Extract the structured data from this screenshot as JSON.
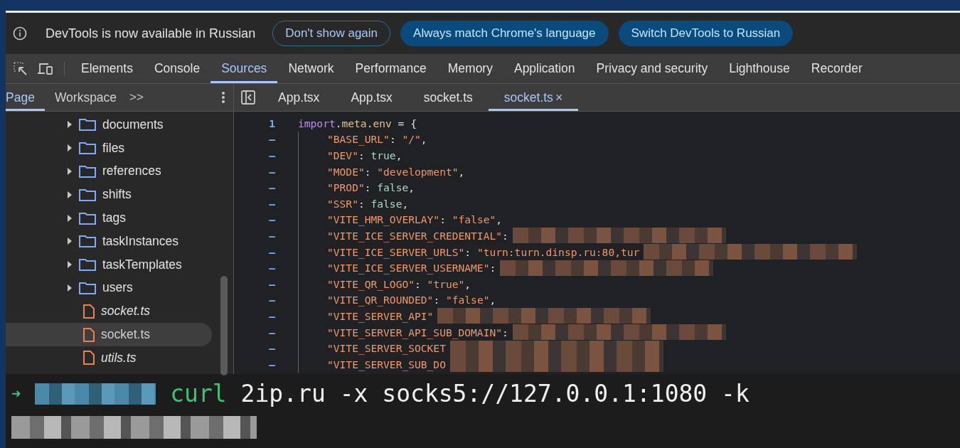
{
  "infobar": {
    "message": "DevTools is now available in Russian",
    "buttons": [
      {
        "label": "Don't show again",
        "kind": "outline"
      },
      {
        "label": "Always match Chrome's language",
        "kind": "filled"
      },
      {
        "label": "Switch DevTools to Russian",
        "kind": "filled"
      }
    ]
  },
  "panel_tabs": [
    {
      "label": "Elements",
      "selected": false
    },
    {
      "label": "Console",
      "selected": false
    },
    {
      "label": "Sources",
      "selected": true
    },
    {
      "label": "Network",
      "selected": false
    },
    {
      "label": "Performance",
      "selected": false
    },
    {
      "label": "Memory",
      "selected": false
    },
    {
      "label": "Application",
      "selected": false
    },
    {
      "label": "Privacy and security",
      "selected": false
    },
    {
      "label": "Lighthouse",
      "selected": false
    },
    {
      "label": "Recorder",
      "selected": false
    }
  ],
  "navigator_tabs": [
    {
      "label": "Page",
      "selected": true
    },
    {
      "label": "Workspace",
      "selected": false
    }
  ],
  "more_tabs": ">>",
  "file_tree": [
    {
      "name": "documents",
      "kind": "folder",
      "expanded": false,
      "italic": false,
      "selected": false
    },
    {
      "name": "files",
      "kind": "folder",
      "expanded": false,
      "italic": false,
      "selected": false
    },
    {
      "name": "references",
      "kind": "folder",
      "expanded": false,
      "italic": false,
      "selected": false
    },
    {
      "name": "shifts",
      "kind": "folder",
      "expanded": false,
      "italic": false,
      "selected": false
    },
    {
      "name": "tags",
      "kind": "folder",
      "expanded": false,
      "italic": false,
      "selected": false
    },
    {
      "name": "taskInstances",
      "kind": "folder",
      "expanded": false,
      "italic": false,
      "selected": false
    },
    {
      "name": "taskTemplates",
      "kind": "folder",
      "expanded": false,
      "italic": false,
      "selected": false
    },
    {
      "name": "users",
      "kind": "folder",
      "expanded": false,
      "italic": false,
      "selected": false
    },
    {
      "name": "socket.ts",
      "kind": "file",
      "italic": true,
      "selected": false
    },
    {
      "name": "socket.ts",
      "kind": "file",
      "italic": false,
      "selected": true
    },
    {
      "name": "utils.ts",
      "kind": "file",
      "italic": true,
      "selected": false
    }
  ],
  "editor_tabs": [
    {
      "label": "App.tsx",
      "selected": false,
      "closable": false
    },
    {
      "label": "App.tsx",
      "selected": false,
      "closable": false
    },
    {
      "label": "socket.ts",
      "selected": false,
      "closable": false
    },
    {
      "label": "socket.ts",
      "selected": true,
      "closable": true
    }
  ],
  "close_glyph": "×",
  "code": [
    {
      "gutter": "1",
      "redacted": false,
      "tokens": [
        {
          "text": "import",
          "kind": "keyword"
        },
        {
          "text": ".",
          "kind": "punct"
        },
        {
          "text": "meta",
          "kind": "member"
        },
        {
          "text": ".",
          "kind": "punct"
        },
        {
          "text": "env",
          "kind": "member"
        },
        {
          "text": " = {",
          "kind": "punct"
        }
      ],
      "children": [
        {
          "gutter": "–",
          "redacted": false,
          "tokens": [
            {
              "text": "\"BASE_URL\"",
              "kind": "string"
            },
            {
              "text": ": ",
              "kind": "punct"
            },
            {
              "text": "\"/\"",
              "kind": "string"
            },
            {
              "text": ",",
              "kind": "punct"
            }
          ]
        },
        {
          "gutter": "–",
          "redacted": false,
          "tokens": [
            {
              "text": "\"DEV\"",
              "kind": "string"
            },
            {
              "text": ": ",
              "kind": "punct"
            },
            {
              "text": "true",
              "kind": "literal"
            },
            {
              "text": ",",
              "kind": "punct"
            }
          ]
        },
        {
          "gutter": "–",
          "redacted": false,
          "tokens": [
            {
              "text": "\"MODE\"",
              "kind": "string"
            },
            {
              "text": ": ",
              "kind": "punct"
            },
            {
              "text": "\"development\"",
              "kind": "string"
            },
            {
              "text": ",",
              "kind": "punct"
            }
          ]
        },
        {
          "gutter": "–",
          "redacted": false,
          "tokens": [
            {
              "text": "\"PROD\"",
              "kind": "string"
            },
            {
              "text": ": ",
              "kind": "punct"
            },
            {
              "text": "false",
              "kind": "literal"
            },
            {
              "text": ",",
              "kind": "punct"
            }
          ]
        },
        {
          "gutter": "–",
          "redacted": false,
          "tokens": [
            {
              "text": "\"SSR\"",
              "kind": "string"
            },
            {
              "text": ": ",
              "kind": "punct"
            },
            {
              "text": "false",
              "kind": "literal"
            },
            {
              "text": ",",
              "kind": "punct"
            }
          ]
        },
        {
          "gutter": "–",
          "redacted": false,
          "tokens": [
            {
              "text": "\"VITE_HMR_OVERLAY\"",
              "kind": "string"
            },
            {
              "text": ": ",
              "kind": "punct"
            },
            {
              "text": "\"false\"",
              "kind": "string"
            },
            {
              "text": ",",
              "kind": "punct"
            }
          ]
        },
        {
          "gutter": "–",
          "redacted": true,
          "tokens": [
            {
              "text": "\"VITE_ICE_SERVER_CREDENTIAL\"",
              "kind": "string"
            },
            {
              "text": ":",
              "kind": "punct"
            }
          ]
        },
        {
          "gutter": "–",
          "redacted": true,
          "tokens": [
            {
              "text": "\"VITE_ICE_SERVER_URLS\"",
              "kind": "string"
            },
            {
              "text": ": ",
              "kind": "punct"
            },
            {
              "text": "\"turn:turn.dinsp.ru:80,tur",
              "kind": "string"
            }
          ]
        },
        {
          "gutter": "–",
          "redacted": true,
          "tokens": [
            {
              "text": "\"VITE_ICE_SERVER_USERNAME\"",
              "kind": "string"
            },
            {
              "text": ":",
              "kind": "punct"
            }
          ]
        },
        {
          "gutter": "–",
          "redacted": false,
          "tokens": [
            {
              "text": "\"VITE_QR_LOGO\"",
              "kind": "string"
            },
            {
              "text": ": ",
              "kind": "punct"
            },
            {
              "text": "\"true\"",
              "kind": "string"
            },
            {
              "text": ",",
              "kind": "punct"
            }
          ]
        },
        {
          "gutter": "–",
          "redacted": false,
          "tokens": [
            {
              "text": "\"VITE_QR_ROUNDED\"",
              "kind": "string"
            },
            {
              "text": ": ",
              "kind": "punct"
            },
            {
              "text": "\"false\"",
              "kind": "string"
            },
            {
              "text": ",",
              "kind": "punct"
            }
          ]
        },
        {
          "gutter": "–",
          "redacted": true,
          "tokens": [
            {
              "text": "\"VITE_SERVER_API\"",
              "kind": "string"
            }
          ]
        },
        {
          "gutter": "–",
          "redacted": true,
          "tokens": [
            {
              "text": "\"VITE_SERVER_API_SUB_DOMAIN\"",
              "kind": "string"
            },
            {
              "text": ":",
              "kind": "punct"
            }
          ]
        },
        {
          "gutter": "–",
          "redacted": true,
          "tokens": [
            {
              "text": "\"VITE_SERVER_SOCKET",
              "kind": "string"
            }
          ]
        },
        {
          "gutter": "–",
          "redacted": true,
          "tokens": [
            {
              "text": "\"VITE_SERVER_SUB_DO",
              "kind": "string"
            }
          ]
        }
      ]
    }
  ],
  "terminal": {
    "prompt": "➜",
    "command": "curl",
    "arguments": "2ip.ru -x socks5://127.0.0.1:1080 -k"
  }
}
